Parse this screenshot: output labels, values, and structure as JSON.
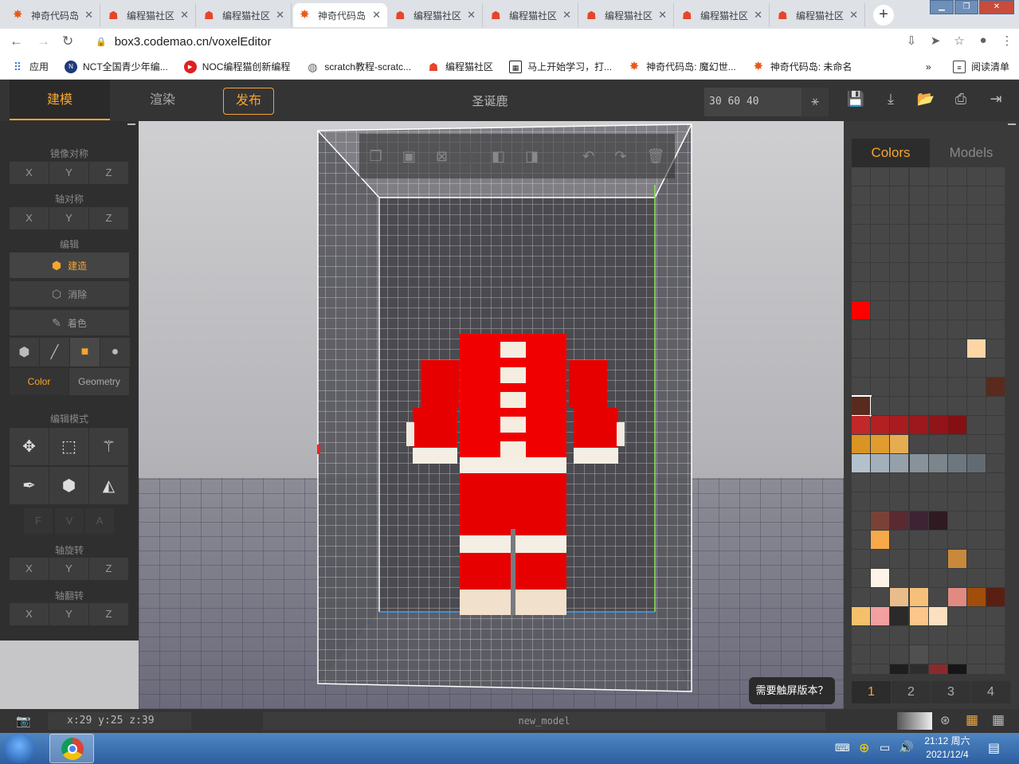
{
  "browser": {
    "tabs": [
      {
        "title": "神奇代码岛",
        "fav": "codemao-star"
      },
      {
        "title": "编程猫社区",
        "fav": "codemao-cat"
      },
      {
        "title": "编程猫社区",
        "fav": "codemao-cat"
      },
      {
        "title": "神奇代码岛",
        "fav": "codemao-star",
        "active": true
      },
      {
        "title": "编程猫社区",
        "fav": "codemao-cat"
      },
      {
        "title": "编程猫社区",
        "fav": "codemao-cat"
      },
      {
        "title": "编程猫社区",
        "fav": "codemao-cat"
      },
      {
        "title": "编程猫社区",
        "fav": "codemao-cat"
      },
      {
        "title": "编程猫社区",
        "fav": "codemao-cat"
      }
    ],
    "url": "box3.codemao.cn/voxelEditor",
    "bookmarks": [
      {
        "label": "应用",
        "icon": "apps-grid-icon"
      },
      {
        "label": "NCT全国青少年编...",
        "icon": "nct-icon"
      },
      {
        "label": "NOC编程猫创新编程",
        "icon": "noc-icon"
      },
      {
        "label": "scratch教程-scratc...",
        "icon": "globe-icon"
      },
      {
        "label": "编程猫社区",
        "icon": "codemao-cat"
      },
      {
        "label": "马上开始学习，打...",
        "icon": "grid-icon"
      },
      {
        "label": "神奇代码岛: 魔幻世...",
        "icon": "codemao-star"
      },
      {
        "label": "神奇代码岛: 未命名",
        "icon": "codemao-star"
      }
    ],
    "reading_list": "阅读清单",
    "more": "»"
  },
  "editor": {
    "tabs": {
      "build": "建模",
      "render": "渲染"
    },
    "publish": "发布",
    "title": "圣诞鹿",
    "size": "30 60 40",
    "left": {
      "mirror": "镜像对称",
      "axis_sym": "轴对称",
      "edit": "编辑",
      "build": "建造",
      "erase": "消除",
      "paint": "着色",
      "color": "Color",
      "geometry": "Geometry",
      "edit_mode": "编辑模式",
      "rotate": "轴旋转",
      "flip": "轴翻转",
      "x": "X",
      "y": "Y",
      "z": "Z",
      "f": "F",
      "v": "V",
      "a": "A"
    },
    "right": {
      "colors": "Colors",
      "models": "Models",
      "pages": [
        "1",
        "2",
        "3",
        "4"
      ]
    },
    "touch_hint": "需要触屏版本？",
    "coords": "x:29 y:25 z:39",
    "model_name": "new_model"
  },
  "taskbar": {
    "time": "21:12 周六",
    "date": "2021/12/4"
  },
  "palette": [
    {
      "c": 0,
      "r": 7,
      "hex": "#ff0000"
    },
    {
      "c": 6,
      "r": 9,
      "hex": "#ffd5a6"
    },
    {
      "c": 7,
      "r": 11,
      "hex": "#5a2a1e"
    },
    {
      "c": 0,
      "r": 12,
      "hex": "#5a2a1e",
      "sel": true
    },
    {
      "c": 0,
      "r": 13,
      "hex": "#c0282a"
    },
    {
      "c": 1,
      "r": 13,
      "hex": "#b22024"
    },
    {
      "c": 2,
      "r": 13,
      "hex": "#a81c20"
    },
    {
      "c": 3,
      "r": 13,
      "hex": "#9c181c"
    },
    {
      "c": 4,
      "r": 13,
      "hex": "#901418"
    },
    {
      "c": 5,
      "r": 13,
      "hex": "#841014"
    },
    {
      "c": 0,
      "r": 14,
      "hex": "#d99423"
    },
    {
      "c": 1,
      "r": 14,
      "hex": "#e09c2e"
    },
    {
      "c": 2,
      "r": 14,
      "hex": "#e6ac52"
    },
    {
      "c": 0,
      "r": 15,
      "hex": "#b3c1cc"
    },
    {
      "c": 1,
      "r": 15,
      "hex": "#a3b0ba"
    },
    {
      "c": 2,
      "r": 15,
      "hex": "#95a1aa"
    },
    {
      "c": 3,
      "r": 15,
      "hex": "#87929a"
    },
    {
      "c": 4,
      "r": 15,
      "hex": "#7a858c"
    },
    {
      "c": 5,
      "r": 15,
      "hex": "#6d777e"
    },
    {
      "c": 6,
      "r": 15,
      "hex": "#626b71"
    },
    {
      "c": 1,
      "r": 18,
      "hex": "#7a4236"
    },
    {
      "c": 2,
      "r": 18,
      "hex": "#5a2a33"
    },
    {
      "c": 3,
      "r": 18,
      "hex": "#3d2333"
    },
    {
      "c": 4,
      "r": 18,
      "hex": "#2f1a22"
    },
    {
      "c": 1,
      "r": 19,
      "hex": "#f7a84a"
    },
    {
      "c": 5,
      "r": 20,
      "hex": "#c9893d"
    },
    {
      "c": 1,
      "r": 21,
      "hex": "#fdf3e6"
    },
    {
      "c": 2,
      "r": 22,
      "hex": "#e8bd8a"
    },
    {
      "c": 3,
      "r": 22,
      "hex": "#f5c07a"
    },
    {
      "c": 5,
      "r": 22,
      "hex": "#e08a82"
    },
    {
      "c": 6,
      "r": 22,
      "hex": "#a04e0a"
    },
    {
      "c": 7,
      "r": 22,
      "hex": "#5a1f12"
    },
    {
      "c": 0,
      "r": 23,
      "hex": "#f5c06a"
    },
    {
      "c": 1,
      "r": 23,
      "hex": "#f2a0a0"
    },
    {
      "c": 2,
      "r": 23,
      "hex": "#2a2a2a"
    },
    {
      "c": 3,
      "r": 23,
      "hex": "#fcc68a"
    },
    {
      "c": 4,
      "r": 23,
      "hex": "#fde0c0"
    },
    {
      "c": 3,
      "r": 25,
      "hex": "#505050"
    },
    {
      "c": 2,
      "r": 26,
      "hex": "#1e1e1e"
    },
    {
      "c": 3,
      "r": 26,
      "hex": "#2e2e2e"
    },
    {
      "c": 4,
      "r": 26,
      "hex": "#8a2a2e"
    },
    {
      "c": 5,
      "r": 26,
      "hex": "#161616"
    },
    {
      "c": 2,
      "r": 27,
      "hex": "#1a1212"
    },
    {
      "c": 3,
      "r": 27,
      "hex": "#2a1a14"
    },
    {
      "c": 4,
      "r": 27,
      "hex": "#3a2216"
    },
    {
      "c": 5,
      "r": 27,
      "hex": "#4a2a18"
    }
  ]
}
